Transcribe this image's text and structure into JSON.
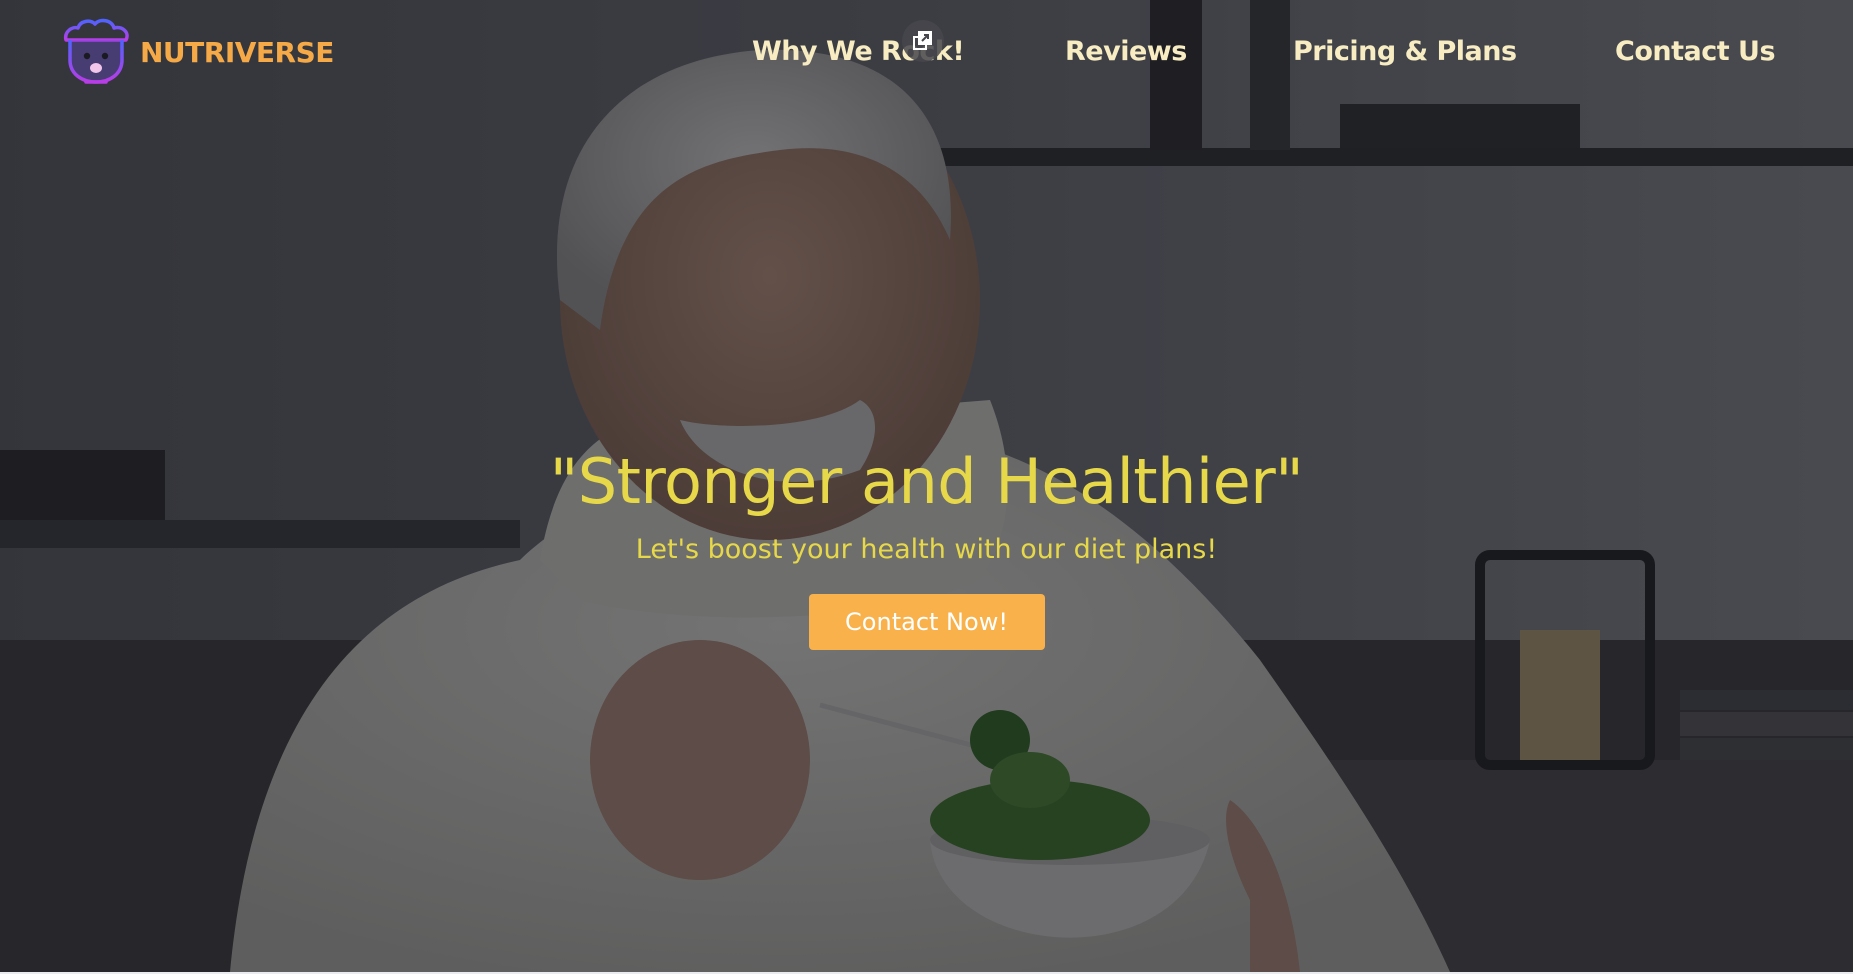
{
  "brand": {
    "name": "NUTRIVERSE",
    "icon": "chef-face-logo-icon",
    "color": "#f5a947"
  },
  "nav": {
    "items": [
      {
        "label": "Why We Rock!"
      },
      {
        "label": "Reviews"
      },
      {
        "label": "Pricing & Plans"
      },
      {
        "label": "Contact Us"
      }
    ],
    "text_color": "#f7ecc2",
    "overlay_icon": "external-window-icon"
  },
  "hero": {
    "title": "\"Stronger and Healthier\"",
    "subtitle": "Let's boost your health with our diet plans!",
    "cta_label": "Contact Now!",
    "accent_color": "#e7d84a",
    "cta_color": "#f9b14b",
    "background": "photo-man-eating-salad"
  }
}
